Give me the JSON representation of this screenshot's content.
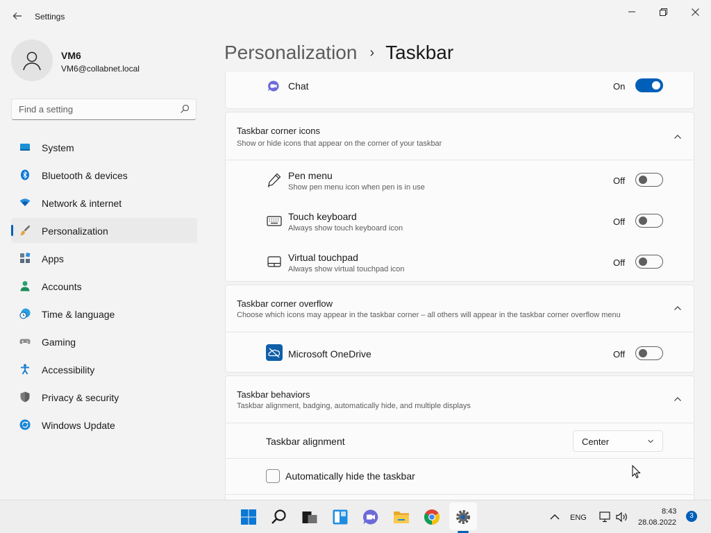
{
  "window": {
    "title": "Settings"
  },
  "user": {
    "name": "VM6",
    "email": "VM6@collabnet.local"
  },
  "search": {
    "placeholder": "Find a setting"
  },
  "nav": {
    "items": [
      {
        "label": "System",
        "icon": "system-icon"
      },
      {
        "label": "Bluetooth & devices",
        "icon": "bluetooth-icon"
      },
      {
        "label": "Network & internet",
        "icon": "wifi-icon"
      },
      {
        "label": "Personalization",
        "icon": "brush-icon",
        "selected": true
      },
      {
        "label": "Apps",
        "icon": "apps-icon"
      },
      {
        "label": "Accounts",
        "icon": "person-icon"
      },
      {
        "label": "Time & language",
        "icon": "clock-globe-icon"
      },
      {
        "label": "Gaming",
        "icon": "gamepad-icon"
      },
      {
        "label": "Accessibility",
        "icon": "accessibility-icon"
      },
      {
        "label": "Privacy & security",
        "icon": "shield-icon"
      },
      {
        "label": "Windows Update",
        "icon": "update-icon"
      }
    ]
  },
  "header": {
    "parent": "Personalization",
    "separator": "›",
    "current": "Taskbar"
  },
  "chat": {
    "label": "Chat",
    "state": "On"
  },
  "corner_icons": {
    "title": "Taskbar corner icons",
    "subtitle": "Show or hide icons that appear on the corner of your taskbar",
    "items": [
      {
        "title": "Pen menu",
        "subtitle": "Show pen menu icon when pen is in use",
        "state": "Off"
      },
      {
        "title": "Touch keyboard",
        "subtitle": "Always show touch keyboard icon",
        "state": "Off"
      },
      {
        "title": "Virtual touchpad",
        "subtitle": "Always show virtual touchpad icon",
        "state": "Off"
      }
    ]
  },
  "corner_overflow": {
    "title": "Taskbar corner overflow",
    "subtitle": "Choose which icons may appear in the taskbar corner – all others will appear in the taskbar corner overflow menu",
    "items": [
      {
        "title": "Microsoft OneDrive",
        "state": "Off"
      }
    ]
  },
  "behaviors": {
    "title": "Taskbar behaviors",
    "subtitle": "Taskbar alignment, badging, automatically hide, and multiple displays",
    "alignment_label": "Taskbar alignment",
    "alignment_value": "Center",
    "autohide_label": "Automatically hide the taskbar"
  },
  "taskbar": {
    "language": "ENG",
    "time": "8:43",
    "date": "28.08.2022",
    "notifications": "3"
  },
  "colors": {
    "accent": "#005fb8",
    "background": "#f3f3f3",
    "card": "#fbfbfb"
  }
}
